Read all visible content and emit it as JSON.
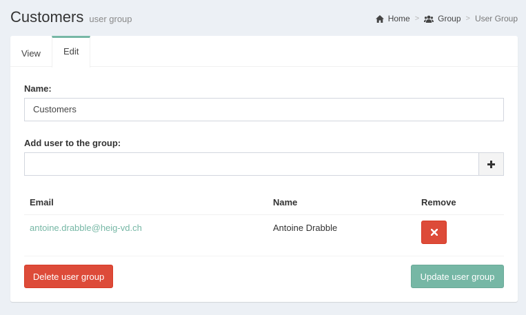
{
  "header": {
    "title": "Customers",
    "subtitle": "user group"
  },
  "breadcrumb": {
    "home": "Home",
    "group": "Group",
    "current": "User Group",
    "separator": ">"
  },
  "tabs": [
    {
      "label": "View",
      "active": false
    },
    {
      "label": "Edit",
      "active": true
    }
  ],
  "form": {
    "name_label": "Name:",
    "name_value": "Customers",
    "add_user_label": "Add user to the group:",
    "add_user_value": ""
  },
  "table": {
    "headers": {
      "email": "Email",
      "name": "Name",
      "remove": "Remove"
    },
    "rows": [
      {
        "email": "antoine.drabble@heig-vd.ch",
        "name": "Antoine Drabble"
      }
    ]
  },
  "actions": {
    "delete_label": "Delete user group",
    "update_label": "Update user group"
  },
  "colors": {
    "accent": "#76b7a5",
    "danger": "#dd4b39",
    "background": "#ecf0f5"
  },
  "icons": [
    "home-icon",
    "users-icon",
    "plus-icon",
    "times-icon"
  ]
}
